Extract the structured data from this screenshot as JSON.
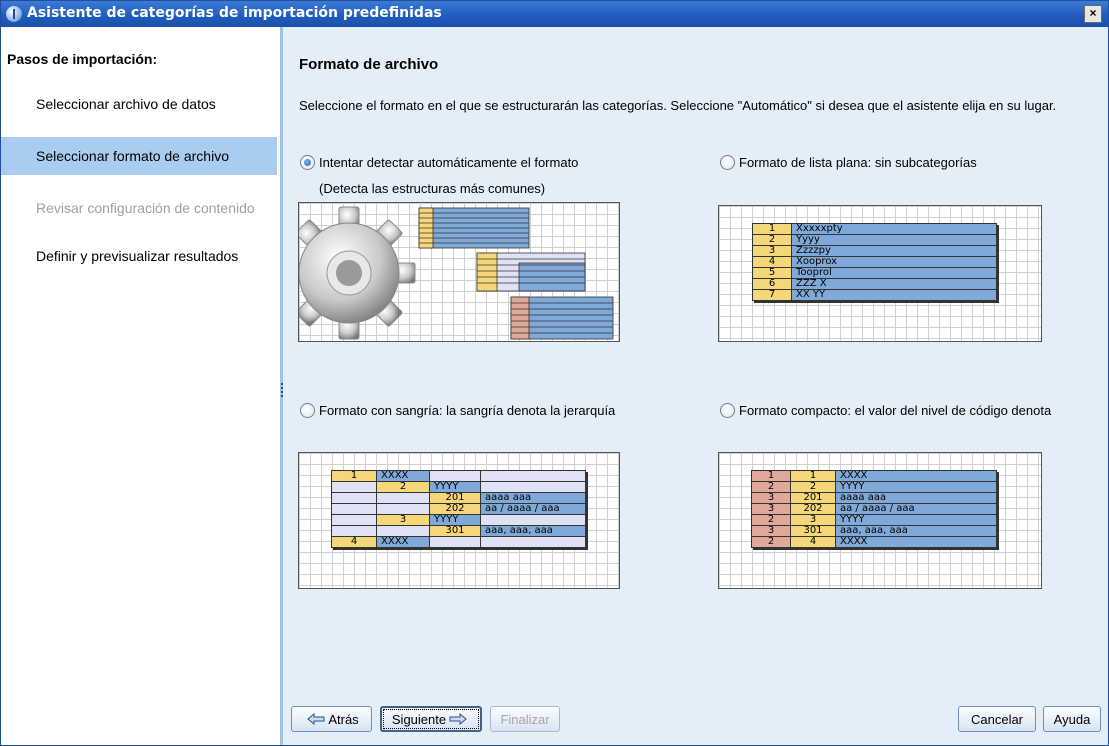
{
  "window": {
    "title": "Asistente de categorías de importación predefinidas",
    "close_label": "×"
  },
  "sidebar": {
    "heading": "Pasos de importación:",
    "steps": [
      {
        "label": "Seleccionar archivo de datos",
        "state": "normal"
      },
      {
        "label": "Seleccionar formato de archivo",
        "state": "selected"
      },
      {
        "label": "Revisar configuración de contenido",
        "state": "disabled"
      },
      {
        "label": "Definir y previsualizar resultados",
        "state": "normal"
      }
    ]
  },
  "main": {
    "title": "Formato de archivo",
    "description": "Seleccione el formato en el que se estructurarán las categorías. Seleccione \"Automático\" si desea que el asistente elija en su lugar.",
    "options": [
      {
        "label": "Intentar detectar automáticamente el formato",
        "sublabel": "(Detecta las estructuras más comunes)",
        "selected": true
      },
      {
        "label": "Formato de lista plana: sin subcategorías",
        "selected": false
      },
      {
        "label": "Formato con sangría: la sangría denota la jerarquía",
        "selected": false
      },
      {
        "label": "Formato compacto: el valor del nivel de código denota",
        "selected": false
      }
    ],
    "flat_example": [
      [
        "1",
        "Xxxxxpty"
      ],
      [
        "2",
        "Yyyy"
      ],
      [
        "3",
        "Zzzzpy"
      ],
      [
        "4",
        "Xooprox"
      ],
      [
        "5",
        "Tooprol"
      ],
      [
        "6",
        "ZZZ X"
      ],
      [
        "7",
        "XX YY"
      ]
    ],
    "indented_example": [
      [
        "1",
        "XXXX",
        "",
        ""
      ],
      [
        "",
        "2",
        "YYYY",
        ""
      ],
      [
        "",
        "",
        "201",
        "aaaa aaa"
      ],
      [
        "",
        "",
        "202",
        "aa / aaaa / aaa"
      ],
      [
        "",
        "3",
        "YYYY",
        ""
      ],
      [
        "",
        "",
        "301",
        "aaa, aaa, aaa"
      ],
      [
        "4",
        "XXXX",
        "",
        ""
      ]
    ],
    "compact_example": [
      [
        "1",
        "1",
        "XXXX"
      ],
      [
        "2",
        "2",
        "YYYY"
      ],
      [
        "3",
        "201",
        "aaaa aaa"
      ],
      [
        "3",
        "202",
        "aa / aaaa / aaa"
      ],
      [
        "2",
        "3",
        "YYYY"
      ],
      [
        "3",
        "301",
        "aaa, aaa, aaa"
      ],
      [
        "2",
        "4",
        "XXXX"
      ]
    ]
  },
  "footer": {
    "back_label": "Atrás",
    "next_label": "Siguiente",
    "finish_label": "Finalizar",
    "cancel_label": "Cancelar",
    "help_label": "Ayuda"
  },
  "colors": {
    "selected_step": "#a8cdf0",
    "content_bg": "#e3eef9",
    "titlebar": "#1f5bbd"
  }
}
